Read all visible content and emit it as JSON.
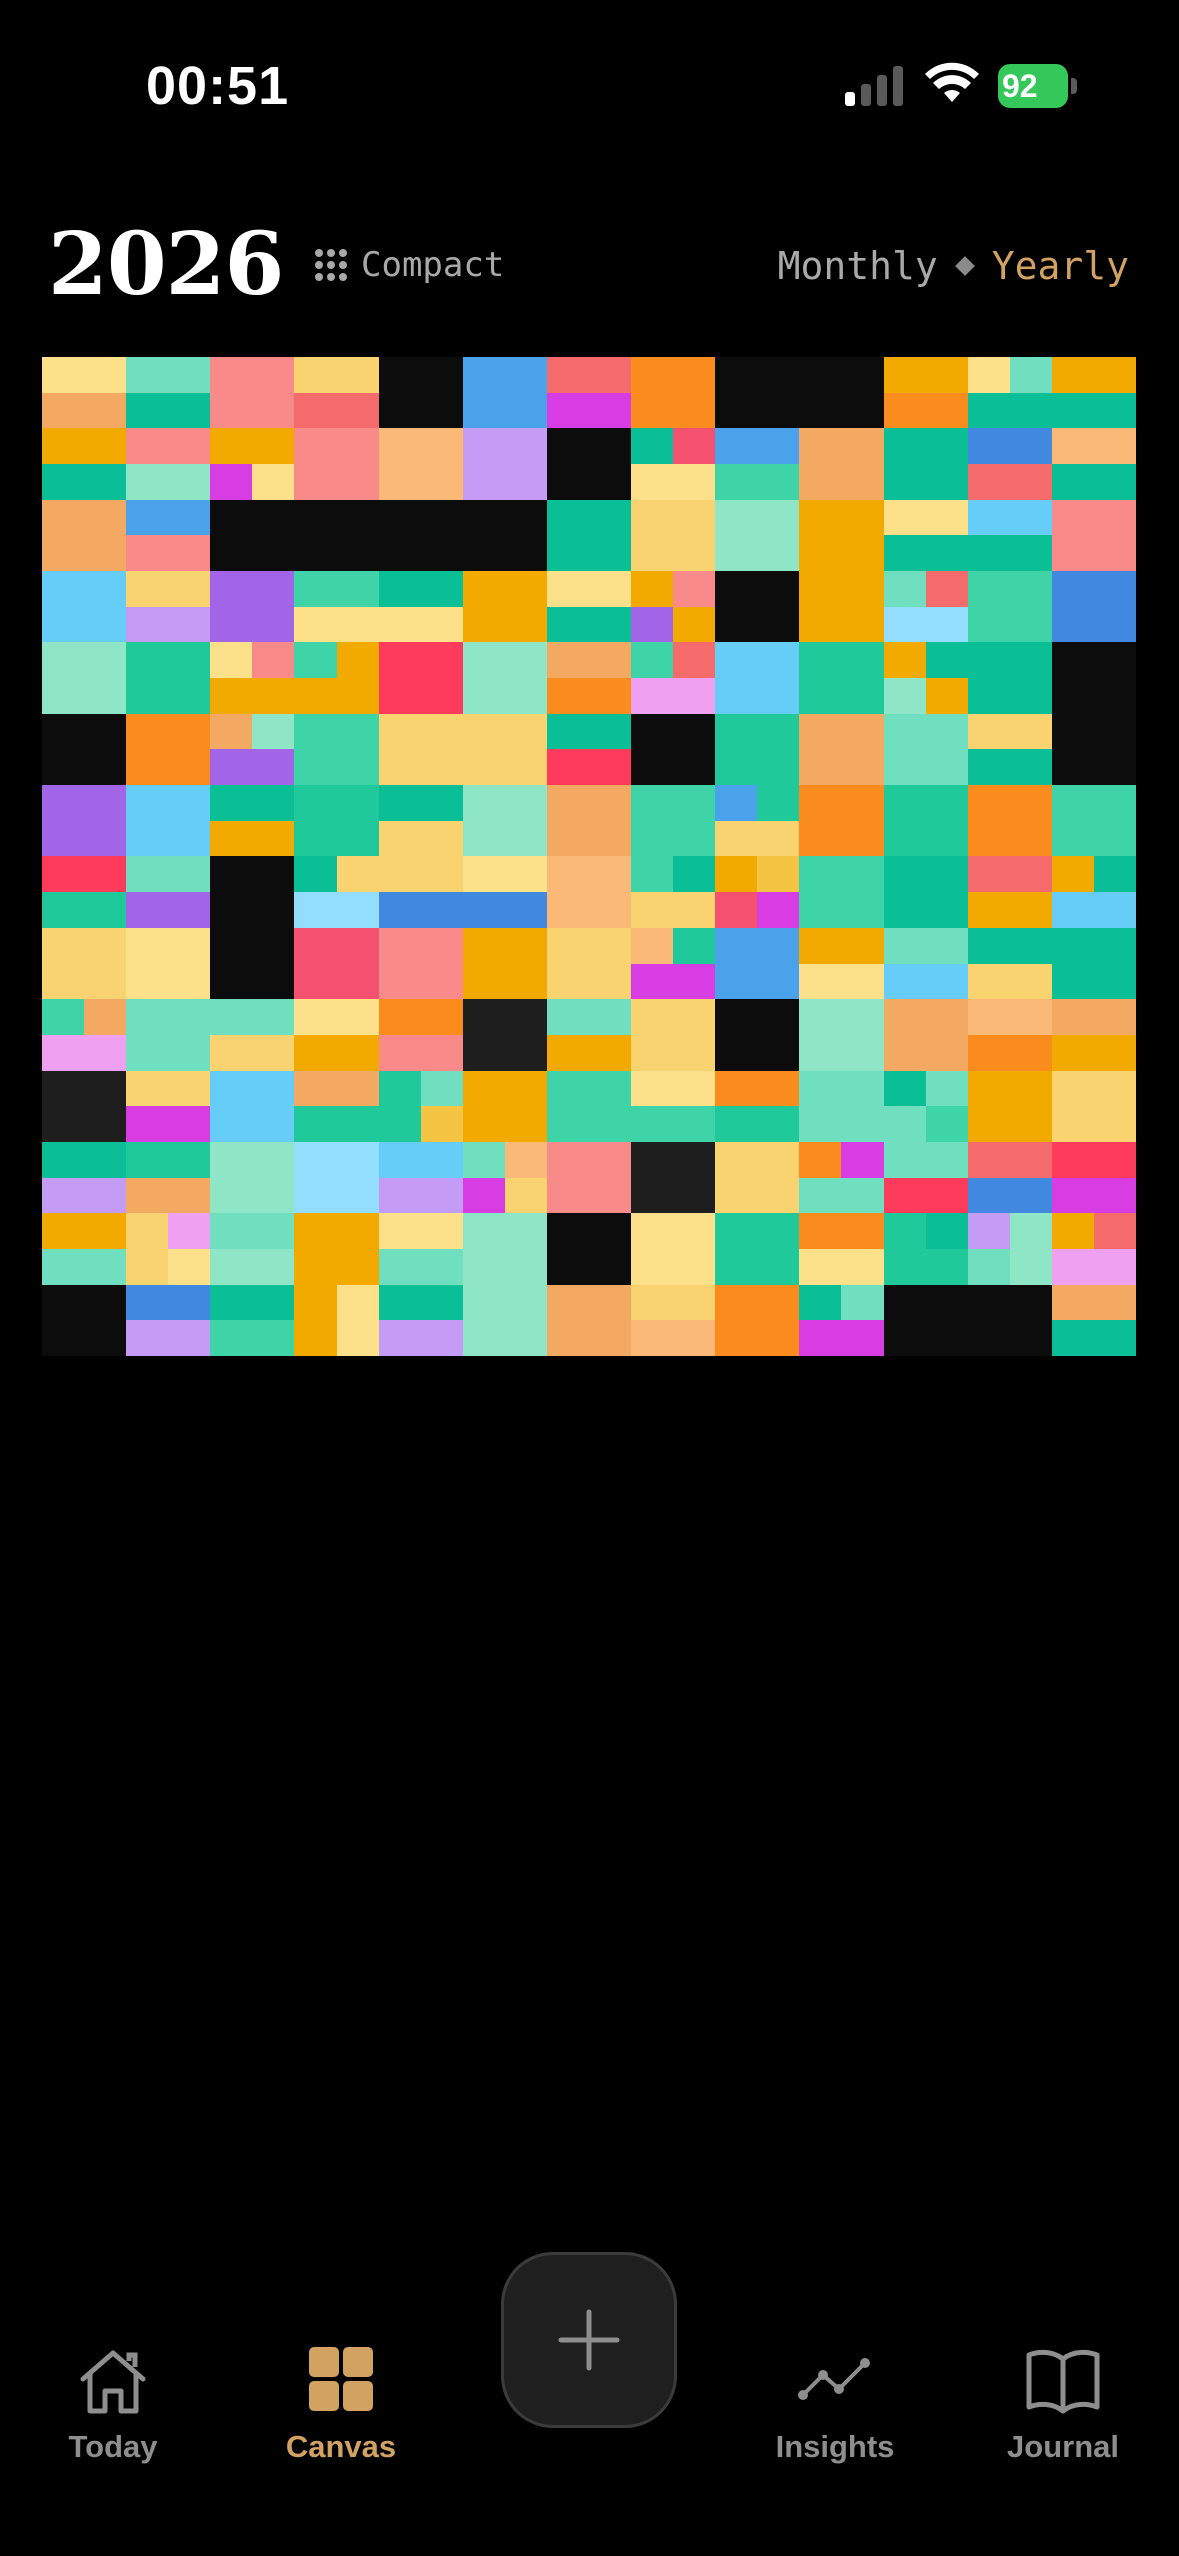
{
  "status_bar": {
    "time": "00:51",
    "battery": "92"
  },
  "header": {
    "year": "2026",
    "compact_label": "Compact",
    "view_monthly": "Monthly",
    "view_yearly": "Yearly",
    "selected_view": "Yearly"
  },
  "colors": {
    "accent": "#d1a262",
    "inactive": "#8e8e8e",
    "palette": {
      "A": "#f2a900",
      "B": "#f4c542",
      "C": "#f8d36f",
      "D": "#fde18a",
      "E": "#f4a962",
      "F": "#fbb978",
      "G": "#fa8c1e",
      "H": "#f88a8a",
      "I": "#f56b6b",
      "J": "#ff3b5c",
      "K": "#f45070",
      "L": "#1fc99a",
      "M": "#0abf95",
      "N": "#3fd4a8",
      "O": "#6fdfbf",
      "P": "#8ee6c6",
      "Q": "#4aa3ea",
      "R": "#4188e0",
      "S": "#66cdf8",
      "T": "#93defd",
      "U": "#a365e8",
      "V": "#c49bf5",
      "W": "#d83de3",
      "X": "#f0a0f0",
      "Y": "#0c0c0c",
      "Z": "#1e1e1e"
    }
  },
  "mosaic": {
    "rows": [
      [
        "DE",
        "OM",
        "H",
        "CI",
        "Y",
        "Q",
        "IW",
        "G",
        "Y",
        "Y",
        "AG",
        "DOMM",
        "AM"
      ],
      [
        "AM",
        "HP",
        "AAWD",
        "HH",
        "F",
        "V",
        "Y",
        "MKDD",
        "QN",
        "E",
        "M",
        "RI",
        "FM"
      ],
      [
        "E",
        "QH",
        "Y",
        "Y",
        "Y",
        "Y",
        "M",
        "C",
        "P",
        "A",
        "DM",
        "SM",
        "H"
      ],
      [
        "S",
        "CV",
        "U",
        "ND",
        "MMDD",
        "A",
        "DM",
        "AHUA",
        "Y",
        "A",
        "OIT T",
        "N",
        "R"
      ],
      [
        "P",
        "L",
        "DHAA",
        "NAAA",
        "J",
        "P",
        "EG",
        "NIXX",
        "S",
        "L",
        "AMPA",
        "M",
        "Y"
      ],
      [
        "Y",
        "G",
        "EPUU",
        "N",
        "C",
        "C",
        "MJ",
        "Y",
        "L",
        "E",
        "O",
        "CM",
        "Y"
      ],
      [
        "U",
        "S",
        "MA",
        "L",
        "MC",
        "P",
        "E",
        "N",
        "QLCC",
        "G",
        "L",
        "G",
        "N",
        "CI"
      ],
      [
        "JL",
        "OU",
        "Y",
        "MCTT",
        "CR",
        "DR",
        "F",
        "NMCC",
        "ABKW",
        "N",
        "M",
        "IA",
        "AMSS"
      ],
      [
        "C",
        "D",
        "Y",
        "K",
        "H",
        "A",
        "C",
        "FLWW",
        "Q",
        "AD",
        "OS",
        "MC",
        "M"
      ],
      [
        "NEXX",
        "O",
        "OC",
        "DA",
        "GH",
        "Z",
        "OA",
        "C",
        "Y",
        "P",
        "E",
        "FG",
        "EA"
      ],
      [
        "Z",
        "CW",
        "S",
        "EL",
        "LOLB",
        "AA",
        "N",
        "DN",
        "GL",
        "O",
        "MOON",
        "AA",
        "C"
      ],
      [
        "MV",
        "LE",
        "P",
        "T",
        "SV",
        "OFWC",
        "H",
        "Z",
        "C",
        "GWOO",
        "OJ",
        "IR",
        "JW"
      ],
      [
        "AO",
        "CXCD",
        "OP",
        "A",
        "DO",
        "P",
        "Y",
        "D",
        "L",
        "GD",
        "LMLL",
        "VPOP",
        "AIXX"
      ],
      [
        "Y",
        "RV",
        "MN",
        "ADAD",
        "MV",
        "P",
        "E",
        "CF",
        "G",
        "MOWW",
        "Y",
        "Y",
        "EEMM"
      ]
    ]
  },
  "tab_bar": {
    "today": "Today",
    "canvas": "Canvas",
    "insights": "Insights",
    "journal": "Journal"
  }
}
